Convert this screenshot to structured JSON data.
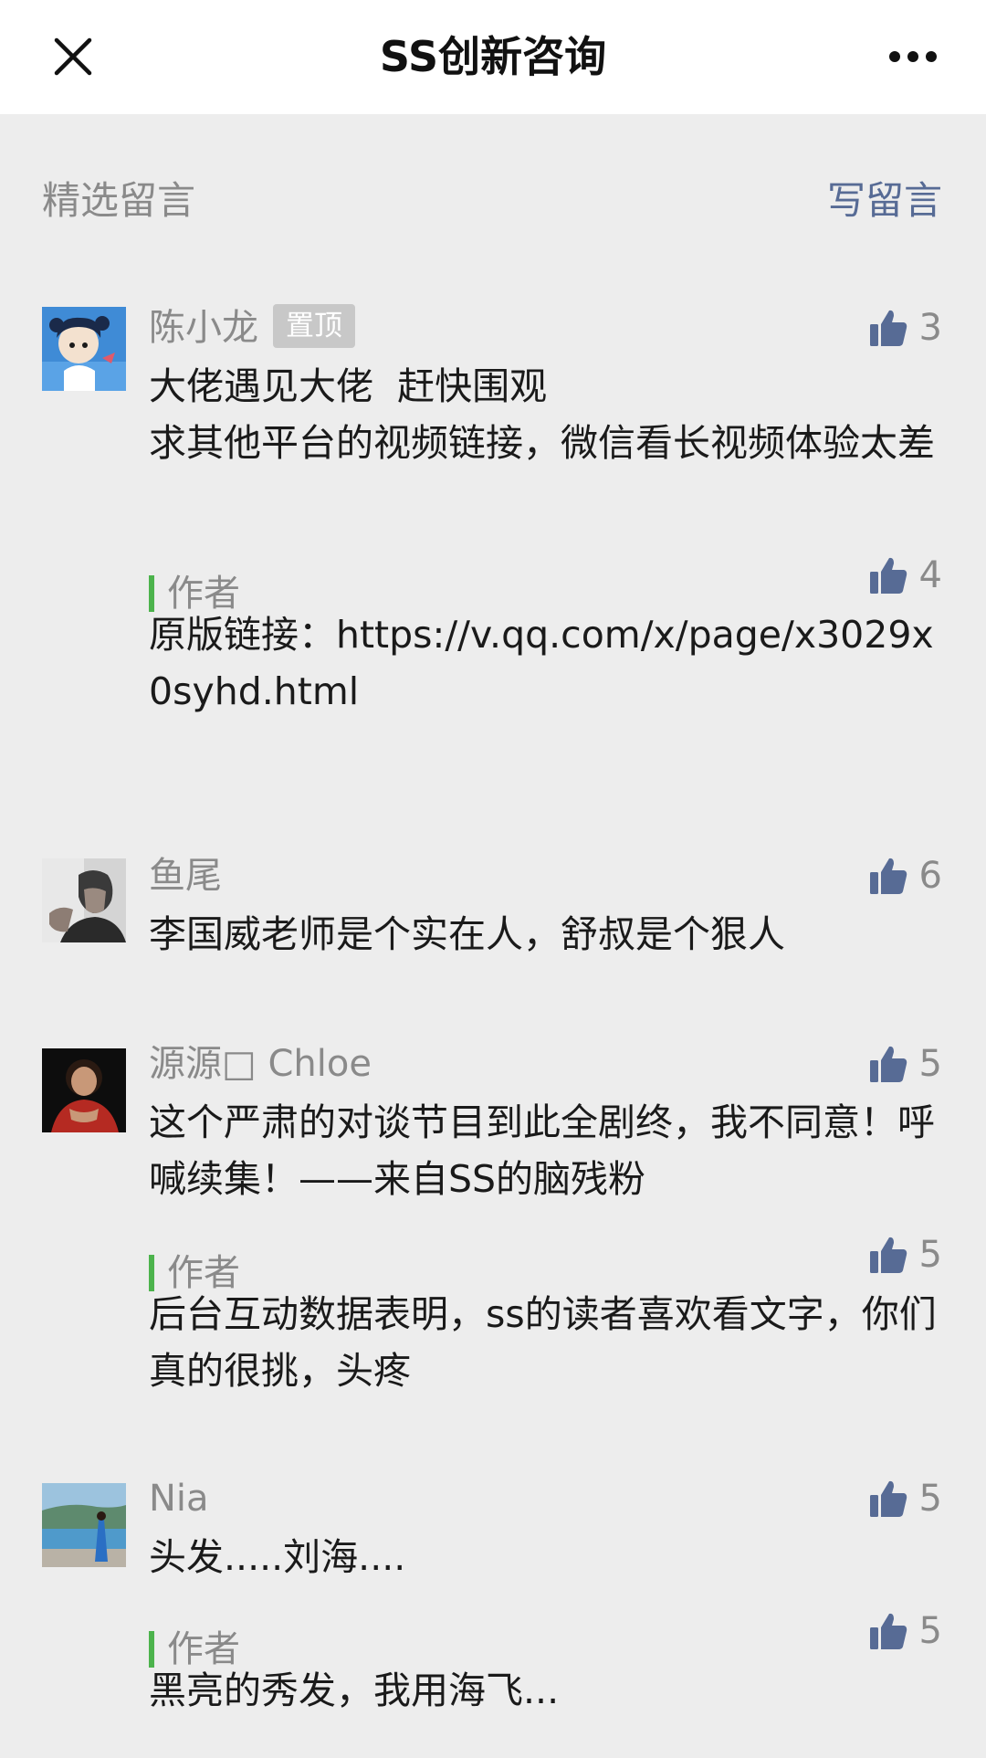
{
  "nav": {
    "title": "SS创新咨询",
    "close_icon": "close-icon",
    "more_icon": "more-icon"
  },
  "section": {
    "title": "精选留言",
    "write_label": "写留言"
  },
  "colors": {
    "link": "#576b95",
    "author_bar": "#4cb34c",
    "like_icon": "#576b95"
  },
  "comments": [
    {
      "name": "陈小龙",
      "badge": "置顶",
      "likes": "3",
      "text": "大佬遇见大佬  赶快围观\n求其他平台的视频链接，微信看长视频体验太差",
      "reply": {
        "label": "作者",
        "likes": "4",
        "text": "原版链接：https://v.qq.com/x/page/x3029x0syhd.html"
      }
    },
    {
      "name": "鱼尾",
      "likes": "6",
      "text": "李国威老师是个实在人，舒叔是个狠人"
    },
    {
      "name": "源源□ Chloe",
      "likes": "5",
      "text": "这个严肃的对谈节目到此全剧终，我不同意！呼喊续集！——来自SS的脑残粉",
      "reply": {
        "label": "作者",
        "likes": "5",
        "text": "后台互动数据表明，ss的读者喜欢看文字，你们真的很挑，头疼"
      }
    },
    {
      "name": "Nia",
      "likes": "5",
      "text": "头发.....刘海....",
      "reply": {
        "label": "作者",
        "likes": "5",
        "text": "黑亮的秀发，我用海飞..."
      }
    }
  ]
}
